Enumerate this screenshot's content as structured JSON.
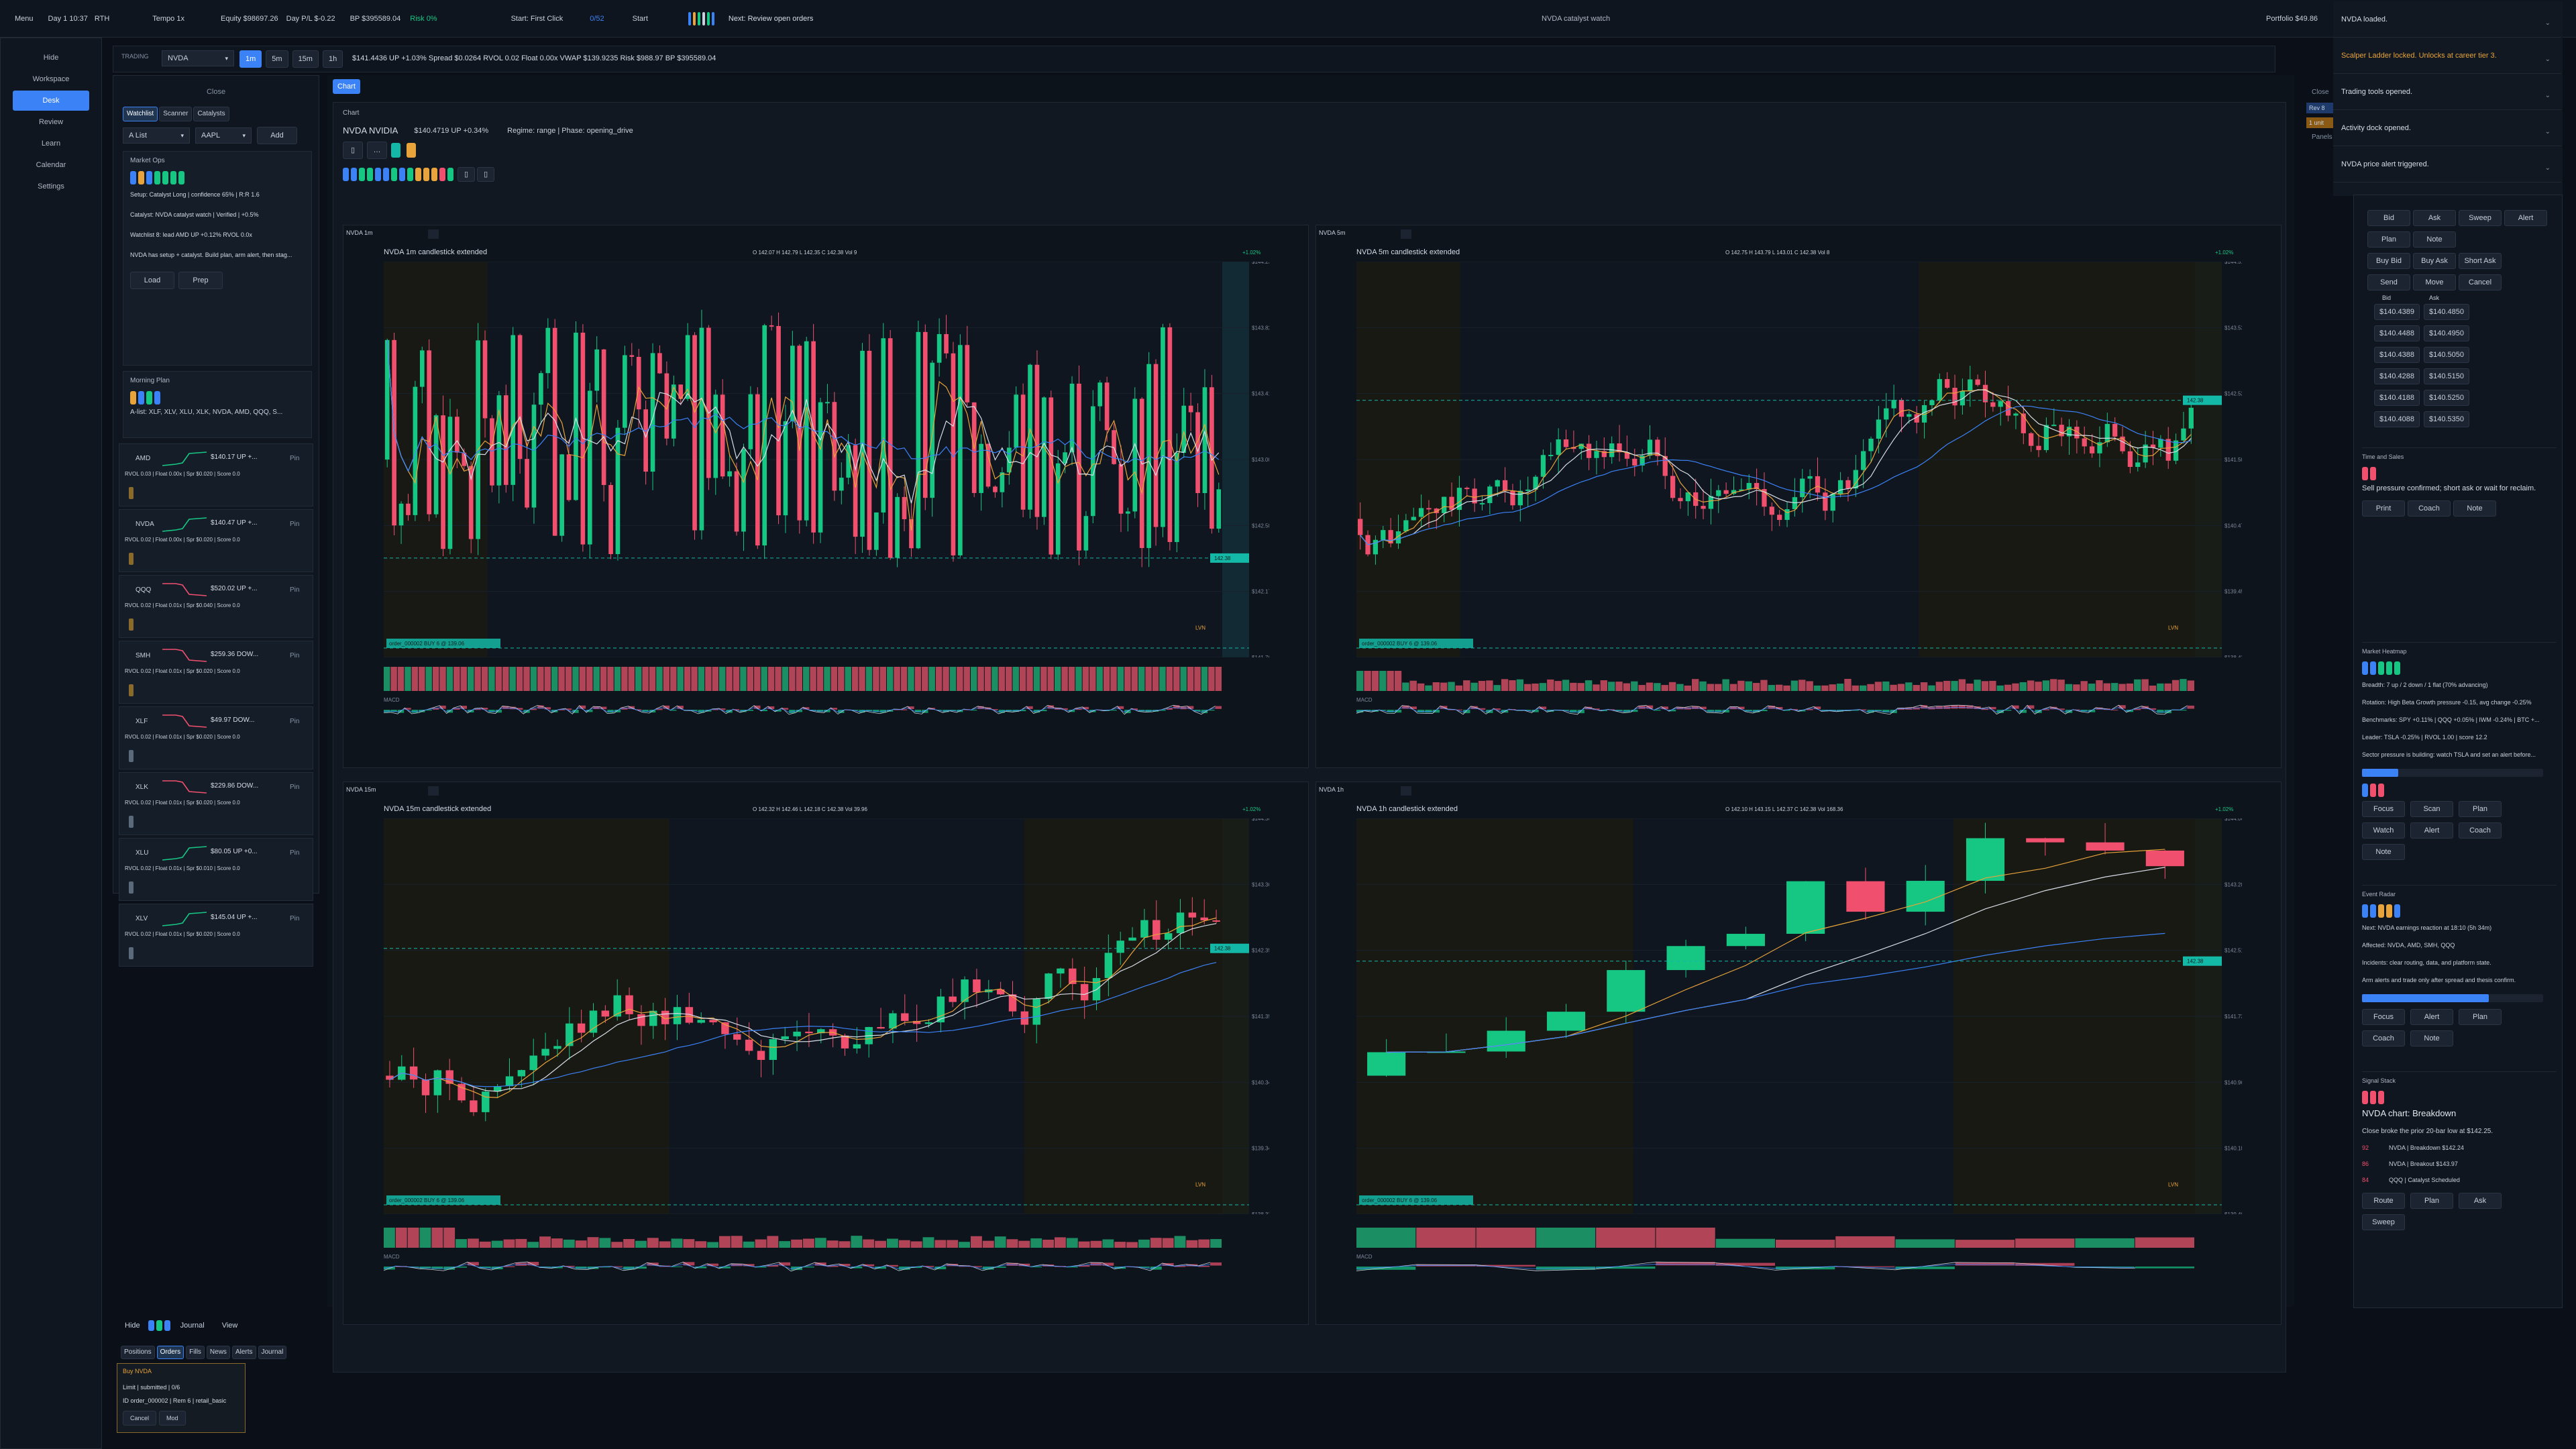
{
  "topbar": {
    "menu": "Menu",
    "session": "Day 1  10:37",
    "session_mode": "RTH",
    "tempo": "Tempo 1x",
    "equity": "Equity $98697.26",
    "day_pl": "Day P/L $-0.22",
    "bp": "BP $395589.04",
    "risk": "Risk 0%",
    "start_hint": "Start: First Click",
    "progress": "0/52",
    "start": "Start",
    "next": "Next: Review open orders",
    "center_title": "NVDA catalyst watch",
    "portfolio": "Portfolio $49.86"
  },
  "nav": {
    "items": [
      "Hide",
      "Workspace",
      "Desk",
      "Review",
      "Learn",
      "Calendar",
      "Settings"
    ],
    "active_index": 2
  },
  "trading": {
    "label": "TRADING",
    "symbol": "NVDA",
    "timeframes": [
      "1m",
      "5m",
      "15m",
      "1h"
    ],
    "active_tf": 0,
    "quote": "$141.4436  UP +1.03%  Spread $0.0264  RVOL 0.02  Float 0.00x  VWAP $139.9235  Risk $988.97  BP $395589.04"
  },
  "watchlist": {
    "close": "Close",
    "tabs": [
      "Watchlist",
      "Scanner",
      "Catalysts"
    ],
    "list_select": "A List",
    "symbol_select": "AAPL",
    "add": "Add",
    "market_ops_title": "Market Ops",
    "market_ops_lines": [
      "Setup: Catalyst Long | confidence 65% | R:R 1.6",
      "Catalyst: NVDA catalyst watch | Verified | +0.5%",
      "Watchlist 8: lead AMD UP +0.12% RVOL 0.0x",
      "NVDA has setup + catalyst. Build plan, arm alert, then stag..."
    ],
    "load": "Load",
    "prep": "Prep",
    "morning_plan_title": "Morning Plan",
    "morning_plan_line": "A-list: XLF, XLV, XLU, XLK, NVDA, AMD, QQQ, S...",
    "pin": "Pin",
    "items": [
      {
        "sym": "AMD",
        "price": "$140.17  UP +...",
        "meta": "RVOL 0.03 | Float 0.00x | Spr $0.020 | Score 0.0",
        "color": "#16c784"
      },
      {
        "sym": "NVDA",
        "price": "$140.47  UP +...",
        "meta": "RVOL 0.02 | Float 0.00x | Spr $0.020 | Score 0.0",
        "color": "#16c784"
      },
      {
        "sym": "QQQ",
        "price": "$520.02  UP +...",
        "meta": "RVOL 0.02 | Float 0.01x | Spr $0.040 | Score 0.0",
        "color": "#f0506e"
      },
      {
        "sym": "SMH",
        "price": "$259.36  DOW...",
        "meta": "RVOL 0.02 | Float 0.01x | Spr $0.020 | Score 0.0",
        "color": "#f0506e"
      },
      {
        "sym": "XLF",
        "price": "$49.97  DOW...",
        "meta": "RVOL 0.02 | Float 0.01x | Spr $0.020 | Score 0.0",
        "color": "#f0506e"
      },
      {
        "sym": "XLK",
        "price": "$229.86  DOW...",
        "meta": "RVOL 0.02 | Float 0.01x | Spr $0.020 | Score 0.0",
        "color": "#f0506e"
      },
      {
        "sym": "XLU",
        "price": "$80.05  UP +0...",
        "meta": "RVOL 0.02 | Float 0.01x | Spr $0.010 | Score 0.0",
        "color": "#16c784"
      },
      {
        "sym": "XLV",
        "price": "$145.04  UP +...",
        "meta": "RVOL 0.02 | Float 0.01x | Spr $0.020 | Score 0.0",
        "color": "#16c784"
      }
    ]
  },
  "chart_header": {
    "tab": "Chart",
    "label": "Chart",
    "title": "NVDA  NVIDIA",
    "price": "$140.4719  UP +0.34%",
    "regime": "Regime: range | Phase: opening_drive"
  },
  "charts": [
    {
      "panel": "NVDA  1m",
      "title": "NVDA  1m  candlestick  extended",
      "ohlc": "O 142.07 H 142.79 L 142.35 C 142.38 Vol 9",
      "change": "+1.02%",
      "ticks": [
        "$144.23",
        "$143.82",
        "$143.41",
        "$143.00",
        "$142.58",
        "$142.17",
        "$141.76"
      ],
      "order": "order_000002 BUY 6 @ 139.06",
      "last": "142.38",
      "lvn": "LVN",
      "macd": "MACD"
    },
    {
      "panel": "NVDA  5m",
      "title": "NVDA  5m  candlestick  extended",
      "ohlc": "O 142.75 H 143.79 L 143.01 C 142.38 Vol 8",
      "change": "+1.02%",
      "ticks": [
        "$144.51",
        "$143.53",
        "$142.52",
        "$141.50",
        "$140.47",
        "$139.45",
        "$138.43"
      ],
      "order": "order_000002 BUY 6 @ 139.06",
      "last": "142.38",
      "lvn": "LVN",
      "macd": "MACD"
    },
    {
      "panel": "NVDA  15m",
      "title": "NVDA  15m  candlestick  extended",
      "ohlc": "O 142.32 H 142.46 L 142.18 C 142.38 Vol 39.96",
      "change": "+1.02%",
      "ticks": [
        "$144.36",
        "$143.36",
        "$142.35",
        "$141.35",
        "$140.34",
        "$139.34",
        "$138.33"
      ],
      "order": "order_000002 BUY 6 @ 139.06",
      "last": "142.38",
      "lvn": "LVN",
      "macd": "MACD"
    },
    {
      "panel": "NVDA  1h",
      "title": "NVDA  1h  candlestick  extended",
      "ohlc": "O 142.10 H 143.15 L 142.37 C 142.38 Vol 168.36",
      "change": "+1.02%",
      "ticks": [
        "$144.06",
        "$143.28",
        "$142.51",
        "$141.73",
        "$140.96",
        "$140.18",
        "$139.40"
      ],
      "order": "order_000002 BUY 6 @ 139.06",
      "last": "142.38",
      "lvn": "LVN",
      "macd": "MACD"
    }
  ],
  "chart_data": [
    {
      "type": "candlestick",
      "timeframe": "1m",
      "ylim": [
        141.76,
        144.23
      ],
      "last": 142.38,
      "order_price": 139.06,
      "candle_count": 120
    },
    {
      "type": "candlestick",
      "timeframe": "5m",
      "ylim": [
        138.43,
        144.51
      ],
      "last": 142.38,
      "order_price": 139.06,
      "candle_count": 110
    },
    {
      "type": "candlestick",
      "timeframe": "15m",
      "ylim": [
        138.33,
        144.36
      ],
      "last": 142.38,
      "order_price": 139.06,
      "candle_count": 70
    },
    {
      "type": "candlestick",
      "timeframe": "1h",
      "ylim": [
        139.4,
        144.06
      ],
      "last": 142.38,
      "order_price": 139.06,
      "candle_count": 14
    }
  ],
  "rightpanel": {
    "close": "Close",
    "badge1": "Rev 8",
    "badge2": "1 unit",
    "panels": "Panels"
  },
  "notifications": [
    {
      "text": "NVDA loaded.",
      "color": "#d7dde6"
    },
    {
      "text": "Scalper Ladder locked. Unlocks at career tier 3.",
      "color": "#e8a33a"
    },
    {
      "text": "Trading tools opened.",
      "color": "#d7dde6"
    },
    {
      "text": "Activity dock opened.",
      "color": "#d7dde6"
    },
    {
      "text": "NVDA price alert triggered.",
      "color": "#d7dde6"
    }
  ],
  "orderentry": {
    "row1": [
      "Bid",
      "Ask",
      "Sweep",
      "Alert"
    ],
    "row2": [
      "Plan",
      "Note"
    ],
    "row3": [
      "Buy Bid",
      "Buy Ask",
      "Short Ask"
    ],
    "row4": [
      "Send",
      "Move",
      "Cancel"
    ],
    "bid_label": "Bid",
    "ask_label": "Ask",
    "bids": [
      "$140.4389",
      "$140.4488",
      "$140.4388",
      "$140.4288",
      "$140.4188",
      "$140.4088"
    ],
    "asks": [
      "$140.4850",
      "$140.4950",
      "$140.5050",
      "$140.5150",
      "$140.5250",
      "$140.5350"
    ]
  },
  "time_sales": {
    "title": "Time and Sales",
    "text": "Sell pressure confirmed; short ask or wait for reclaim.",
    "buttons": [
      "Print",
      "Coach",
      "Note"
    ]
  },
  "heatmap": {
    "title": "Market Heatmap",
    "lines": [
      "Breadth: 7 up / 2 down / 1 flat (70% advancing)",
      "Rotation: High Beta Growth pressure -0.15, avg change -0.25%",
      "Benchmarks: SPY +0.11% | QQQ +0.05% | IWM -0.24% | BTC +...",
      "Leader: TSLA -0.25% | RVOL 1.00 | score 12.2",
      "Sector pressure is building: watch TSLA and set an alert before..."
    ],
    "progress": 0.2,
    "buttons": [
      "Focus",
      "Scan",
      "Plan",
      "Watch",
      "Alert",
      "Coach",
      "Note"
    ]
  },
  "event_radar": {
    "title": "Event Radar",
    "lines": [
      "Next: NVDA earnings reaction at 18:10 (5h 34m)",
      "Affected: NVDA, AMD, SMH, QQQ",
      "Incidents: clear routing, data, and platform state.",
      "Arm alerts and trade only after spread and thesis confirm."
    ],
    "progress": 0.7,
    "buttons": [
      "Focus",
      "Alert",
      "Plan",
      "Coach",
      "Note"
    ]
  },
  "signal_stack": {
    "title": "Signal Stack",
    "headline": "NVDA chart: Breakdown",
    "subline": "Close broke the prior 20-bar low at $142.25.",
    "items": [
      {
        "n": "92",
        "text": "NVDA | Breakdown $142.24"
      },
      {
        "n": "86",
        "text": "NVDA | Breakout $143.97"
      },
      {
        "n": "84",
        "text": "QQQ | Catalyst Scheduled"
      }
    ],
    "buttons": [
      "Route",
      "Plan",
      "Ask",
      "Sweep"
    ]
  },
  "dock": {
    "hide": "Hide",
    "journal": "Journal",
    "view": "View",
    "tabs": [
      "Positions",
      "Orders",
      "Fills",
      "News",
      "Alerts",
      "Journal"
    ],
    "active_tab": 1,
    "order_title": "Buy NVDA",
    "order_line1": "Limit | submitted | 0/6",
    "order_line2": "ID order_000002 | Rem 6 | retail_basic",
    "cancel": "Cancel",
    "mod": "Mod"
  }
}
